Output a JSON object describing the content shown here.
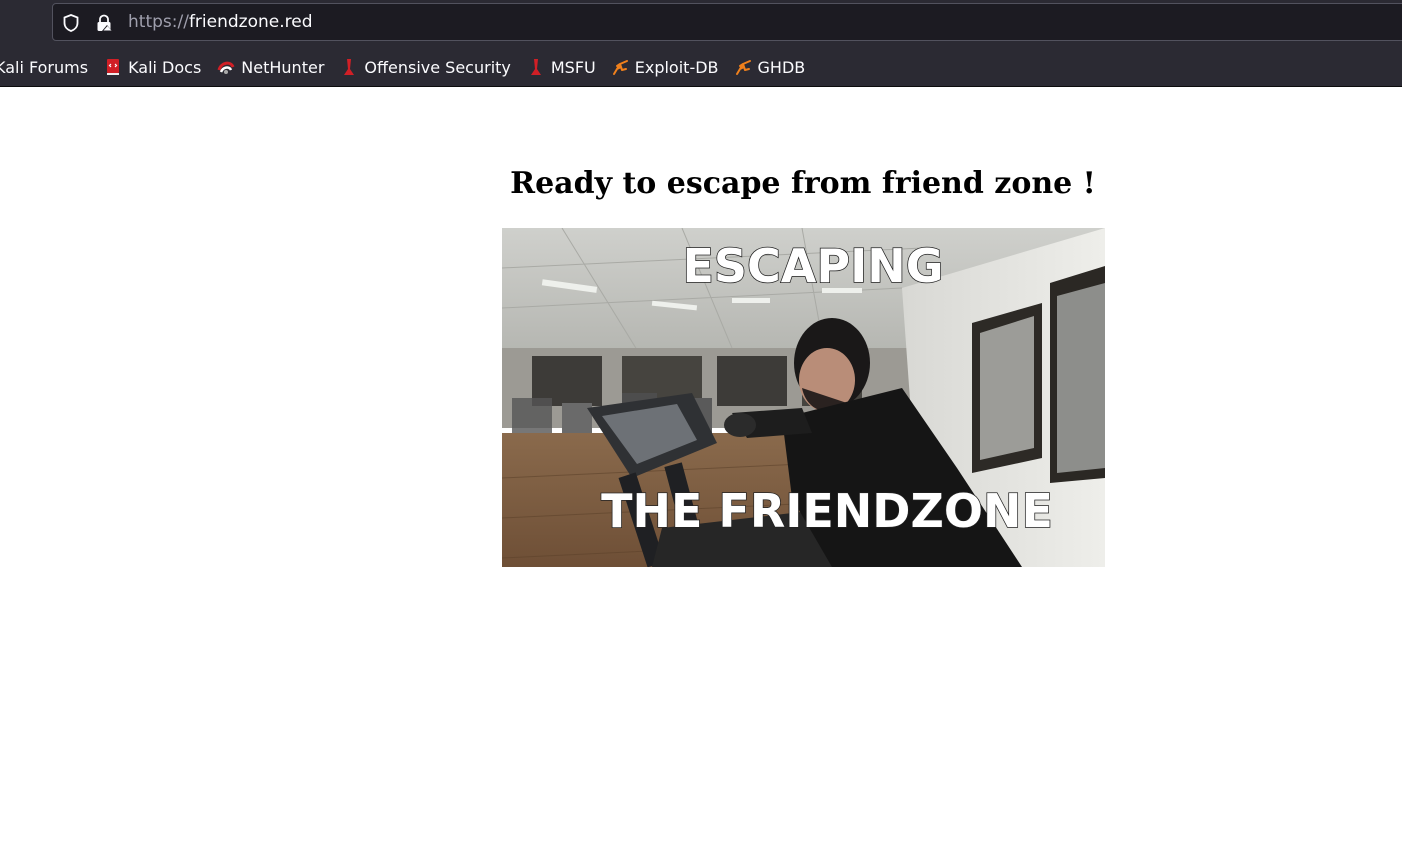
{
  "browser": {
    "url_scheme": "https://",
    "url_host": "friendzone.red",
    "bookmarks": [
      {
        "label": "Kali Forums",
        "icon": "kali-forums-icon"
      },
      {
        "label": "Kali Docs",
        "icon": "kali-docs-icon"
      },
      {
        "label": "NetHunter",
        "icon": "nethunter-icon"
      },
      {
        "label": "Offensive Security",
        "icon": "offsec-icon"
      },
      {
        "label": "MSFU",
        "icon": "offsec-icon"
      },
      {
        "label": "Exploit-DB",
        "icon": "exploit-db-icon"
      },
      {
        "label": "GHDB",
        "icon": "exploit-db-icon"
      }
    ]
  },
  "page": {
    "heading": "Ready to escape from friend zone !",
    "meme": {
      "top_text": "ESCAPING",
      "bottom_text": "THE FRIENDZONE"
    }
  },
  "colors": {
    "chrome_bg": "#2b2a33",
    "url_bar_bg": "#1c1b22",
    "kali_red": "#d11f26",
    "exploitdb_orange": "#f0801c"
  }
}
